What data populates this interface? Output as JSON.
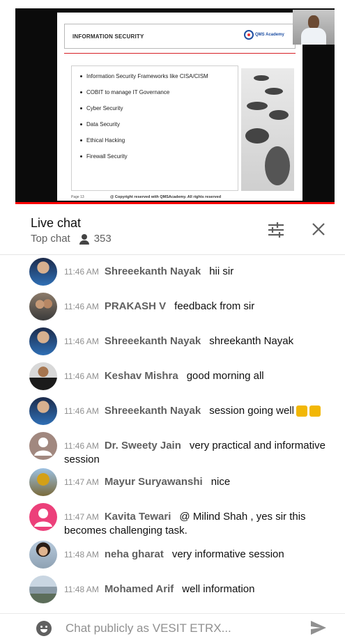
{
  "slide": {
    "title": "INFORMATION SECURITY",
    "logo_text": "QMS Academy",
    "bullets": [
      "Information Security Frameworks like CISA/CISM",
      "COBIT to manage IT Governance",
      "Cyber Security",
      "Data Security",
      "Ethical Hacking",
      "Firewall Security"
    ],
    "page_label": "Page 13",
    "footer": "@ Copyright reserved with QMSAcademy. All rights reserved"
  },
  "chat": {
    "title": "Live chat",
    "mode": "Top chat",
    "viewer_count": "353"
  },
  "messages": [
    {
      "time": "11:46 AM",
      "author": "Shreeekanth Nayak",
      "text": "hii sir"
    },
    {
      "time": "11:46 AM",
      "author": "PRAKASH V",
      "text": "feedback from sir"
    },
    {
      "time": "11:46 AM",
      "author": "Shreeekanth Nayak",
      "text": "shreekanth Nayak"
    },
    {
      "time": "11:46 AM",
      "author": "Keshav Mishra",
      "text": "good morning all"
    },
    {
      "time": "11:46 AM",
      "author": "Shreeekanth Nayak",
      "text": "session going well"
    },
    {
      "time": "11:46 AM",
      "author": "Dr. Sweety Jain",
      "text": "very practical and informative session"
    },
    {
      "time": "11:47 AM",
      "author": "Mayur Suryawanshi",
      "text": "nice"
    },
    {
      "time": "11:47 AM",
      "author": "Kavita Tewari",
      "text": "@ Milind Shah , yes sir this becomes challenging task."
    },
    {
      "time": "11:48 AM",
      "author": "neha gharat",
      "text": "very informative session"
    },
    {
      "time": "11:48 AM",
      "author": "Mohamed Arif",
      "text": "well information"
    }
  ],
  "input": {
    "placeholder": "Chat publicly as VESIT ETRX..."
  },
  "colors": {
    "progress": "#ff0000",
    "author": "#606060",
    "time": "#909090",
    "avatar_default_brown": "#a1887f",
    "avatar_default_pink": "#ec407a"
  },
  "icons": {
    "filter": "tune-icon",
    "close": "close-icon",
    "viewers": "person-icon",
    "emoji": "smile-icon",
    "send": "send-icon"
  }
}
